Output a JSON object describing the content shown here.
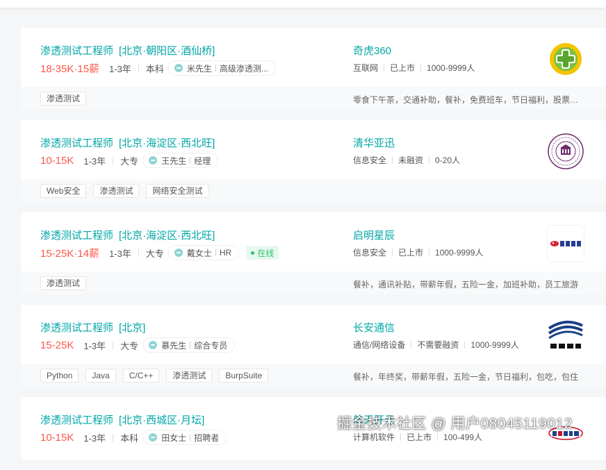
{
  "jobs": [
    {
      "title": "渗透测试工程师",
      "area": "[北京·朝阳区·酒仙桥]",
      "salary": "18-35K·15薪",
      "experience": "1-3年",
      "degree": "本科",
      "recruiter": "米先生",
      "recruiter_title": "高级渗透测...",
      "online": "",
      "company": "奇虎360",
      "company_tags": [
        "互联网",
        "已上市",
        "1000-9999人"
      ],
      "skills": [
        "渗透测试"
      ],
      "welfare": "零食下午茶，交通补助，餐补，免费班车，节日福利，股票期权",
      "logo": "qihoo-360-logo"
    },
    {
      "title": "渗透测试工程师",
      "area": "[北京·海淀区·西北旺]",
      "salary": "10-15K",
      "experience": "1-3年",
      "degree": "大专",
      "recruiter": "王先生",
      "recruiter_title": "经理",
      "online": "",
      "company": "清华亚迅",
      "company_tags": [
        "信息安全",
        "未融资",
        "0-20人"
      ],
      "skills": [
        "Web安全",
        "渗透测试",
        "网络安全测试"
      ],
      "welfare": "",
      "logo": "tsinghua-yaxun-logo"
    },
    {
      "title": "渗透测试工程师",
      "area": "[北京·海淀区·西北旺]",
      "salary": "15-25K·14薪",
      "experience": "1-3年",
      "degree": "大专",
      "recruiter": "戴女士",
      "recruiter_title": "HR",
      "online": "在线",
      "company": "启明星辰",
      "company_tags": [
        "信息安全",
        "已上市",
        "1000-9999人"
      ],
      "skills": [
        "渗透测试"
      ],
      "welfare": "餐补，通讯补贴，带薪年假，五险一金，加班补助，员工旅游",
      "logo": "venustech-logo"
    },
    {
      "title": "渗透测试工程师",
      "area": "[北京]",
      "salary": "15-25K",
      "experience": "1-3年",
      "degree": "大专",
      "recruiter": "慕先生",
      "recruiter_title": "综合专员",
      "online": "",
      "company": "长安通信",
      "company_tags": [
        "通信/网络设备",
        "不需要融资",
        "1000-9999人"
      ],
      "skills": [
        "Python",
        "Java",
        "C/C++",
        "渗透测试",
        "BurpSuite"
      ],
      "welfare": "餐补，年终奖，带薪年假，五险一金，节日福利，包吃，包住",
      "logo": "changan-tongxin-logo"
    },
    {
      "title": "渗透测试工程师",
      "area": "[北京·西城区·月坛]",
      "salary": "10-15K",
      "experience": "1-3年",
      "degree": "本科",
      "recruiter": "田女士",
      "recruiter_title": "招聘者",
      "online": "",
      "company": "航天开元",
      "company_tags": [
        "计算机软件",
        "已上市",
        "100-499人"
      ],
      "skills": [],
      "welfare": "",
      "logo": "cosic-logo"
    }
  ],
  "watermark": "掘金技术社区 @ 用户08045119012",
  "colors": {
    "accent": "#00a6a7",
    "salary": "#fe574a",
    "online": "#2ec26a"
  }
}
